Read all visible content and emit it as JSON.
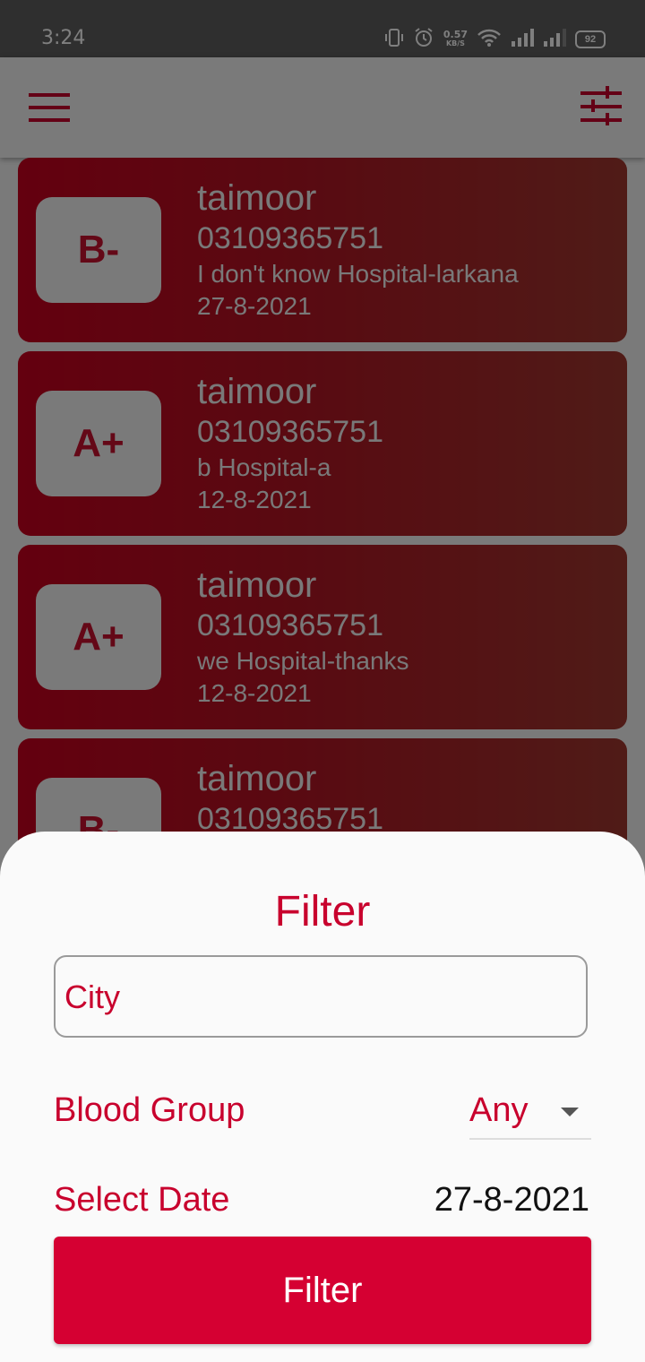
{
  "status_bar": {
    "time": "3:24",
    "net_speed_value": "0.57",
    "net_speed_unit": "KB/S",
    "battery": "92"
  },
  "app_bar": {
    "menu_icon": "hamburger-menu-icon",
    "filter_icon": "tune-sliders-icon"
  },
  "donors": [
    {
      "blood_group": "B-",
      "name": "taimoor",
      "phone": "03109365751",
      "address": "I don't know Hospital-larkana",
      "date": "27-8-2021"
    },
    {
      "blood_group": "A+",
      "name": "taimoor",
      "phone": "03109365751",
      "address": "b Hospital-a",
      "date": "12-8-2021"
    },
    {
      "blood_group": "A+",
      "name": "taimoor",
      "phone": "03109365751",
      "address": "we Hospital-thanks",
      "date": "12-8-2021"
    },
    {
      "blood_group": "B-",
      "name": "taimoor",
      "phone": "03109365751",
      "address": "",
      "date": ""
    }
  ],
  "filter_sheet": {
    "title": "Filter",
    "city_placeholder": "City",
    "city_value": "",
    "blood_group_label": "Blood Group",
    "blood_group_selected": "Any",
    "date_label": "Select Date",
    "date_value": "27-8-2021",
    "submit_label": "Filter"
  },
  "colors": {
    "primary": "#d50032",
    "card_gradient_start": "#c8001e",
    "card_gradient_end": "#a0372f",
    "scrim": "rgba(0,0,0,0.5)"
  }
}
